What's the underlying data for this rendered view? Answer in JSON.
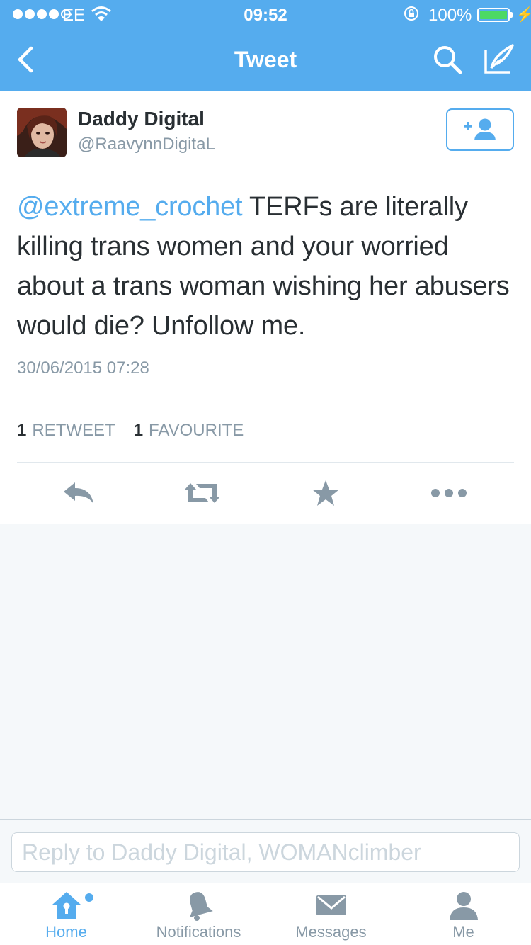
{
  "status_bar": {
    "carrier": "EE",
    "time": "09:52",
    "battery": "100%"
  },
  "nav": {
    "title": "Tweet",
    "back_icon": "chevron-left-icon",
    "search_icon": "search-icon",
    "compose_icon": "compose-icon"
  },
  "tweet": {
    "author_name": "Daddy Digital",
    "author_handle": "@RaavynnDigitaL",
    "mention": "@extreme_crochet",
    "text": " TERFs are literally killing trans women and your worried about a trans woman wishing her abusers would die? Unfollow me.",
    "timestamp": "30/06/2015 07:28",
    "retweet_count": "1",
    "retweet_label": "RETWEET",
    "favourite_count": "1",
    "favourite_label": "FAVOURITE"
  },
  "reply": {
    "placeholder": "Reply to Daddy Digital, WOMANclimber"
  },
  "tabs": [
    {
      "label": "Home",
      "icon": "home-icon"
    },
    {
      "label": "Notifications",
      "icon": "bell-icon"
    },
    {
      "label": "Messages",
      "icon": "envelope-icon"
    },
    {
      "label": "Me",
      "icon": "person-icon"
    }
  ],
  "colors": {
    "brand": "#55acee",
    "text": "#292f33",
    "muted": "#8899a6",
    "action_icon": "#8899a6"
  }
}
